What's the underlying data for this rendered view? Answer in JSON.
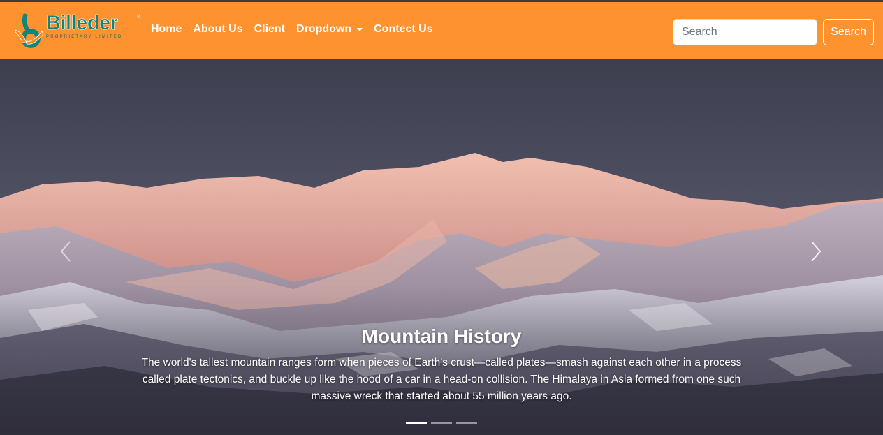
{
  "brand": {
    "name": "Billeder",
    "tagline": "PROPRIETARY LIMITED",
    "mark": "®",
    "colors": {
      "teal": "#10857c",
      "orange": "#f58a1f"
    }
  },
  "nav": {
    "background": "#fe922e",
    "links": [
      {
        "label": "Home"
      },
      {
        "label": "About Us"
      },
      {
        "label": "Client"
      },
      {
        "label": "Dropdown"
      },
      {
        "label": "Contect Us"
      }
    ]
  },
  "search": {
    "placeholder": "Search",
    "button_label": "Search"
  },
  "carousel": {
    "active_index": 0,
    "slide_count": 3,
    "caption": {
      "title": "Mountain History",
      "text": "The world's tallest mountain ranges form when pieces of Earth's crust—called plates—smash against each other in a process called plate tectonics, and buckle up like the hood of a car in a head-on collision. The Himalaya in Asia formed from one such massive wreck that started about 55 million years ago."
    },
    "prev_icon": "chevron-left-icon",
    "next_icon": "chevron-right-icon"
  }
}
